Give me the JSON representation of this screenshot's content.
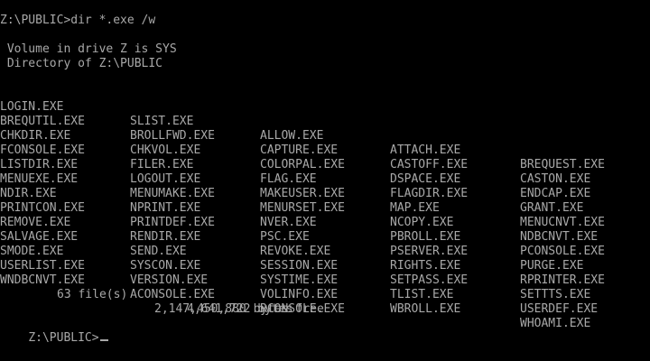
{
  "terminal": {
    "command_line": "Z:\\PUBLIC>dir *.exe /w",
    "volume_line": " Volume in drive Z is SYS",
    "directory_line": " Directory of Z:\\PUBLIC",
    "rows": [
      [
        "LOGIN.EXE",
        "SLIST.EXE",
        "ALLOW.EXE",
        "ATTACH.EXE",
        "BREQUEST.EXE"
      ],
      [
        "BREQUTIL.EXE",
        "BROLLFWD.EXE",
        "CAPTURE.EXE",
        "CASTOFF.EXE",
        "CASTON.EXE"
      ],
      [
        "CHKDIR.EXE",
        "CHKVOL.EXE",
        "COLORPAL.EXE",
        "DSPACE.EXE",
        "ENDCAP.EXE"
      ],
      [
        "FCONSOLE.EXE",
        "FILER.EXE",
        "FLAG.EXE",
        "FLAGDIR.EXE",
        "GRANT.EXE"
      ],
      [
        "LISTDIR.EXE",
        "LOGOUT.EXE",
        "MAKEUSER.EXE",
        "MAP.EXE",
        "MENUCNVT.EXE"
      ],
      [
        "MENUEXE.EXE",
        "MENUMAKE.EXE",
        "MENURSET.EXE",
        "NCOPY.EXE",
        "NDBCNVT.EXE"
      ],
      [
        "NDIR.EXE",
        "NPRINT.EXE",
        "NVER.EXE",
        "PBROLL.EXE",
        "PCONSOLE.EXE"
      ],
      [
        "PRINTCON.EXE",
        "PRINTDEF.EXE",
        "PSC.EXE",
        "PSERVER.EXE",
        "PURGE.EXE"
      ],
      [
        "REMOVE.EXE",
        "RENDIR.EXE",
        "REVOKE.EXE",
        "RIGHTS.EXE",
        "RPRINTER.EXE"
      ],
      [
        "SALVAGE.EXE",
        "SEND.EXE",
        "SESSION.EXE",
        "SETPASS.EXE",
        "SETTTS.EXE"
      ],
      [
        "SMODE.EXE",
        "SYSCON.EXE",
        "SYSTIME.EXE",
        "TLIST.EXE",
        "USERDEF.EXE"
      ],
      [
        "USERLIST.EXE",
        "VERSION.EXE",
        "VOLINFO.EXE",
        "WBROLL.EXE",
        "WHOAMI.EXE"
      ],
      [
        "WNDBCNVT.EXE",
        "ACONSOLE.EXE",
        "RCONSOLE.EXE",
        "",
        ""
      ]
    ],
    "summary": {
      "file_count": "63 file(s)",
      "bytes_used": "4,641,722 bytes",
      "bytes_free": "2,147,450,880 bytes free"
    },
    "prompt": "Z:\\PUBLIC>"
  },
  "colors": {
    "background": "#000000",
    "foreground": "#a8a8a8"
  },
  "icons": {
    "cursor": "text-cursor-underscore"
  }
}
